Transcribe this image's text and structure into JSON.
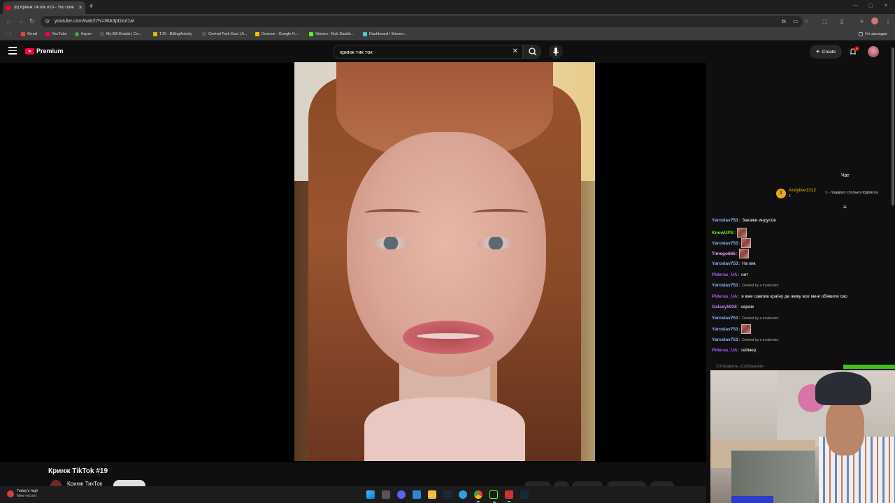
{
  "browser": {
    "tab_title": "(6) Кринж TikTok #19 - YouTube",
    "url": "youtube.com/watch?v=WA3pDzvl1aI",
    "bookmarks": [
      "Gmail",
      "YouTube",
      "Карти",
      "My Bill Details | Co...",
      "TJX - BillingActivity",
      "Central Park East | A...",
      "Devices - Google H...",
      "Stream - Kick Dashb...",
      "Dashboard / Stream..."
    ],
    "all_bookmarks": "Усі закладки"
  },
  "youtube": {
    "logo_text": "Premium",
    "search_query": "кринж тик ток",
    "create_label": "Create",
    "notification_count": "6"
  },
  "video": {
    "title": "Кринж TikTok #19",
    "channel": "Кринж ТикТок"
  },
  "chat": {
    "header": "Чат",
    "pinned": {
      "coin": "1",
      "user": "Andylive1312",
      "sub_count": "1",
      "gift_text": "1 - подарил столько подписок"
    },
    "colors": {
      "yaroslav": "#8ab4f8",
      "knowups": "#53fc18",
      "timego": "#e89cff",
      "pideras": "#b05cff",
      "galaxy": "#c77dff"
    },
    "messages": [
      {
        "user": "Yaroslav753",
        "text": "Закажи индусов",
        "color_key": "yaroslav"
      },
      {
        "user": "KnowUPS",
        "text": "",
        "emote": true,
        "color_key": "knowups"
      },
      {
        "user": "Yaroslav753",
        "text": "",
        "emote": true,
        "color_key": "yaroslav"
      },
      {
        "user": "Timego666",
        "text": "",
        "emote": true,
        "color_key": "timego"
      },
      {
        "user": "Yaroslav753",
        "text": "На кик",
        "color_key": "yaroslav"
      },
      {
        "user": "Pideras_UA",
        "text": "нет",
        "color_key": "pideras"
      },
      {
        "user": "Yaroslav753",
        "text": "Deleted by a moderator",
        "mod": true,
        "color_key": "yaroslav"
      },
      {
        "user": "Pideras_UA",
        "text": "я вже савлив країну де живу все мені обявили сво",
        "color_key": "pideras"
      },
      {
        "user": "Galaxy5928",
        "text": "харам",
        "color_key": "galaxy"
      },
      {
        "user": "Yaroslav753",
        "text": "Deleted by a moderator",
        "mod": true,
        "color_key": "yaroslav"
      },
      {
        "user": "Yaroslav753",
        "text": "",
        "emote": true,
        "color_key": "yaroslav"
      },
      {
        "user": "Yaroslav753",
        "text": "Deleted by a moderator",
        "mod": true,
        "color_key": "yaroslav"
      },
      {
        "user": "Pideras_UA",
        "text": "геймер",
        "color_key": "pideras"
      }
    ],
    "input_placeholder": "Отправить сообщение"
  },
  "taskbar": {
    "weather_line1": "Today's high",
    "weather_line2": "New record"
  }
}
